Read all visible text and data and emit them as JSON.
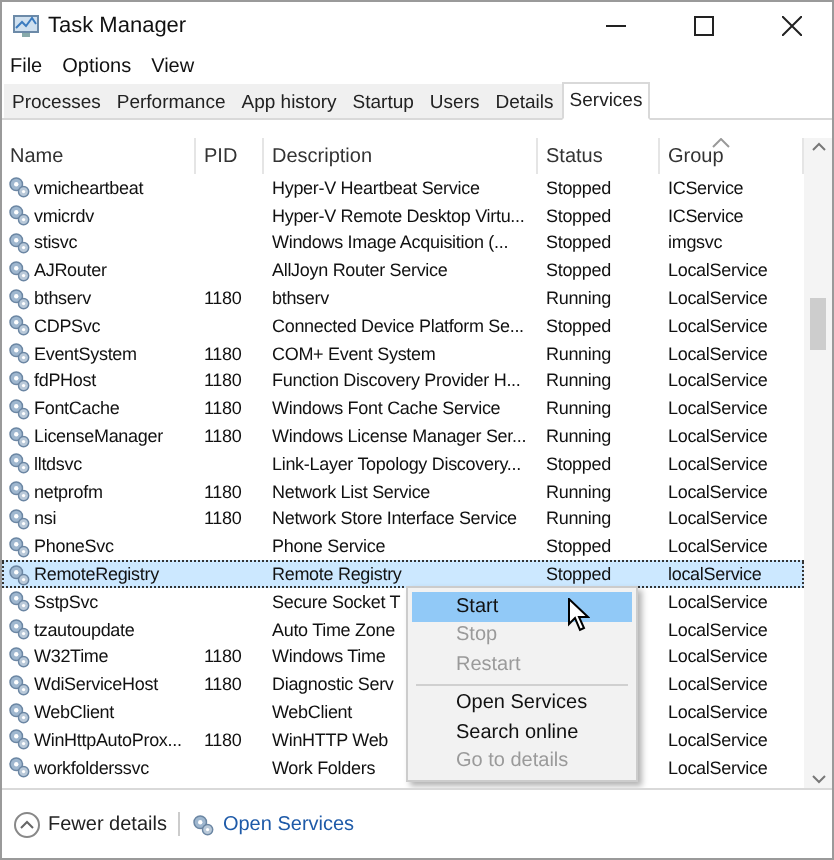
{
  "window": {
    "title": "Task Manager"
  },
  "menu": [
    "File",
    "Options",
    "View"
  ],
  "tabs": [
    {
      "label": "Processes",
      "selected": false
    },
    {
      "label": "Performance",
      "selected": false
    },
    {
      "label": "App history",
      "selected": false
    },
    {
      "label": "Startup",
      "selected": false
    },
    {
      "label": "Users",
      "selected": false
    },
    {
      "label": "Details",
      "selected": false
    },
    {
      "label": "Services",
      "selected": true
    }
  ],
  "table": {
    "columns": [
      "Name",
      "PID",
      "Description",
      "Status",
      "Group"
    ],
    "rows": [
      {
        "name": "vmicheartbeat",
        "description": "Hyper-V Heartbeat Service",
        "status": "Stopped",
        "group": "ICService",
        "selected": false
      },
      {
        "name": "vmicrdv",
        "description": "Hyper-V Remote Desktop Virtu...",
        "status": "Stopped",
        "group": "ICService",
        "selected": false
      },
      {
        "name": "stisvc",
        "description": "Windows Image Acquisition (...",
        "status": "Stopped",
        "group": "imgsvc",
        "selected": false
      },
      {
        "name": "AJRouter",
        "description": "AllJoyn Router Service",
        "status": "Stopped",
        "group": "LocalService",
        "selected": false
      },
      {
        "name": "bthserv",
        "pid": "1180",
        "description": "bthserv",
        "status": "Running",
        "group": "LocalService",
        "selected": false
      },
      {
        "name": "CDPSvc",
        "description": "Connected Device Platform Se...",
        "status": "Stopped",
        "group": "LocalService",
        "selected": false
      },
      {
        "name": "EventSystem",
        "pid": "1180",
        "description": "COM+ Event System",
        "status": "Running",
        "group": "LocalService",
        "selected": false
      },
      {
        "name": "fdPHost",
        "pid": "1180",
        "description": "Function Discovery Provider H...",
        "status": "Running",
        "group": "LocalService",
        "selected": false
      },
      {
        "name": "FontCache",
        "pid": "1180",
        "description": "Windows Font Cache Service",
        "status": "Running",
        "group": "LocalService",
        "selected": false
      },
      {
        "name": "LicenseManager",
        "pid": "1180",
        "description": "Windows License Manager Ser...",
        "status": "Running",
        "group": "LocalService",
        "selected": false
      },
      {
        "name": "lltdsvc",
        "description": "Link-Layer Topology Discovery...",
        "status": "Stopped",
        "group": "LocalService",
        "selected": false
      },
      {
        "name": "netprofm",
        "pid": "1180",
        "description": "Network List Service",
        "status": "Running",
        "group": "LocalService",
        "selected": false
      },
      {
        "name": "nsi",
        "pid": "1180",
        "description": "Network Store Interface Service",
        "status": "Running",
        "group": "LocalService",
        "selected": false
      },
      {
        "name": "PhoneSvc",
        "description": "Phone Service",
        "status": "Stopped",
        "group": "LocalService",
        "selected": false
      },
      {
        "name": "RemoteRegistry",
        "description": "Remote Registry",
        "status": "Stopped",
        "group": "localService",
        "selected": true
      },
      {
        "name": "SstpSvc",
        "description": "Secure Socket T",
        "group": "LocalService",
        "selected": false
      },
      {
        "name": "tzautoupdate",
        "description": "Auto Time Zone",
        "group": "LocalService",
        "selected": false
      },
      {
        "name": "W32Time",
        "pid": "1180",
        "description": "Windows Time",
        "group": "LocalService",
        "selected": false
      },
      {
        "name": "WdiServiceHost",
        "pid": "1180",
        "description": "Diagnostic Serv",
        "group": "LocalService",
        "selected": false
      },
      {
        "name": "WebClient",
        "description": "WebClient",
        "group": "LocalService",
        "selected": false
      },
      {
        "name": "WinHttpAutoProx...",
        "pid": "1180",
        "description": "WinHTTP Web",
        "group": "LocalService",
        "selected": false
      },
      {
        "name": "workfolderssvc",
        "description": "Work Folders",
        "group": "LocalService",
        "selected": false
      }
    ]
  },
  "context_menu": {
    "items": [
      {
        "label": "Start",
        "selected": true,
        "disabled": false
      },
      {
        "label": "Stop",
        "selected": false,
        "disabled": true
      },
      {
        "label": "Restart",
        "selected": false,
        "disabled": true,
        "separator_after": true
      },
      {
        "label": "Open Services",
        "selected": false,
        "disabled": false
      },
      {
        "label": "Search online",
        "selected": false,
        "disabled": false
      },
      {
        "label": "Go to details",
        "selected": false,
        "disabled": true
      }
    ]
  },
  "footer": {
    "fewer_details": "Fewer details",
    "open_services": "Open Services"
  }
}
